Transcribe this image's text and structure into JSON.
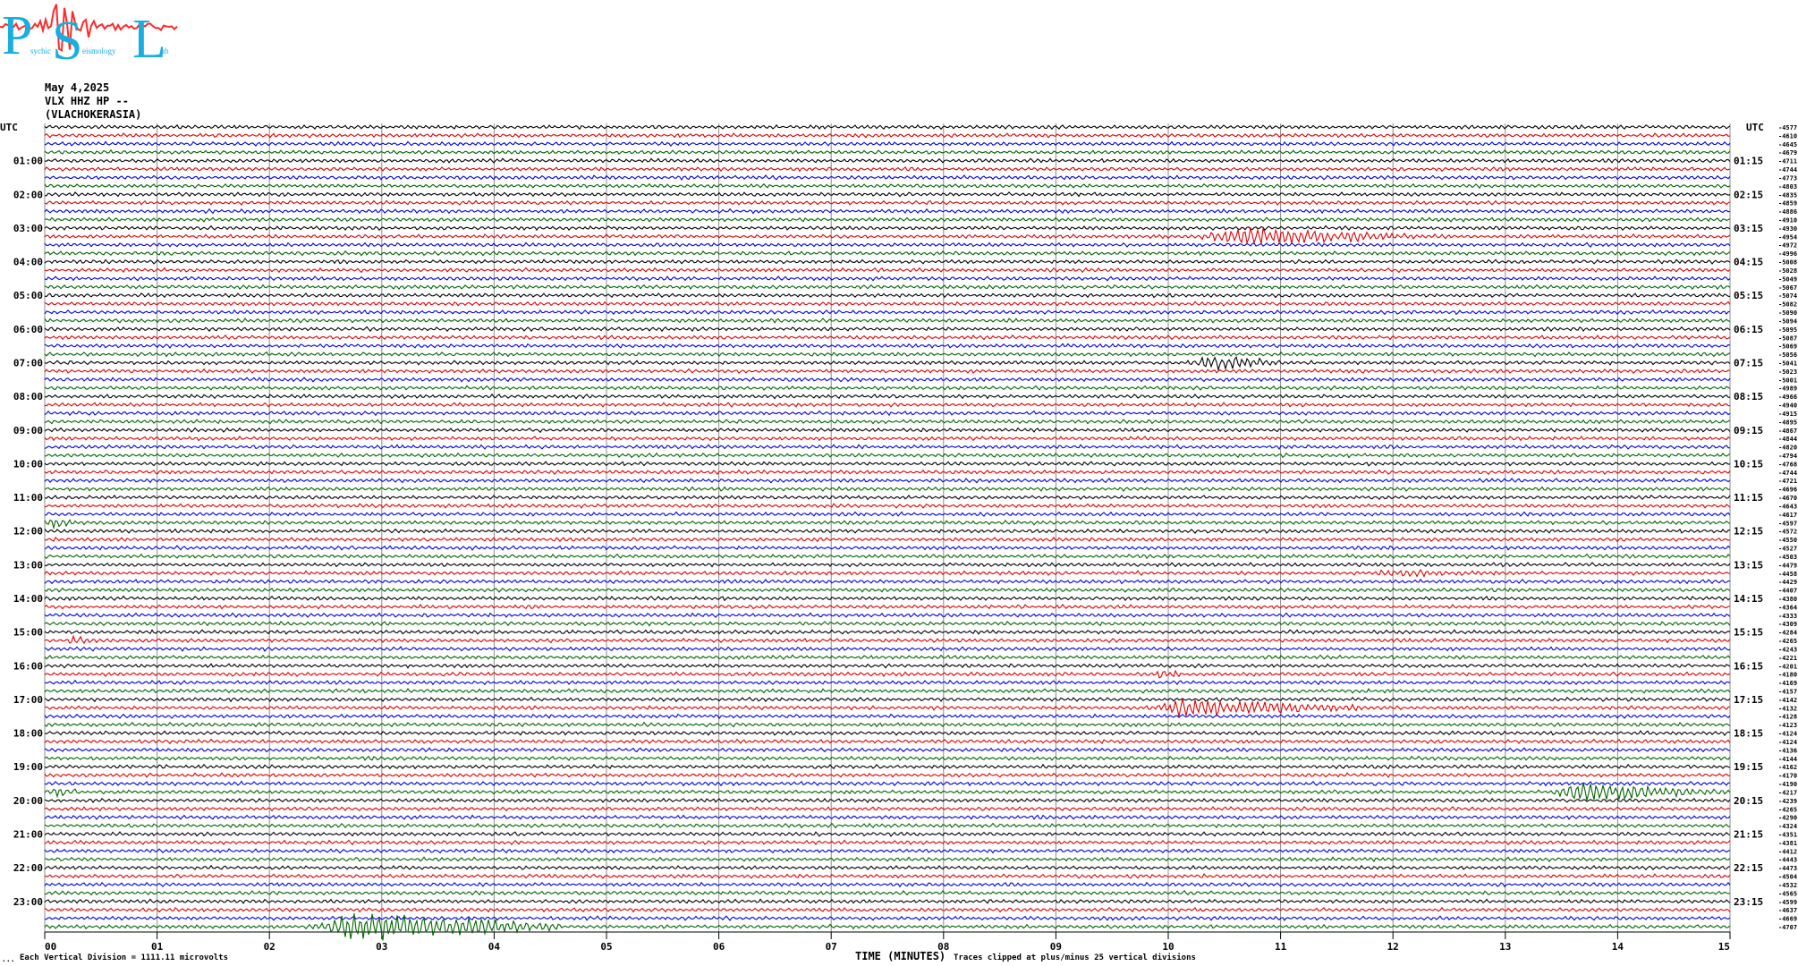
{
  "logo": {
    "letters": [
      "P",
      "S",
      "L"
    ],
    "small_words": [
      "sychic",
      "eismology",
      "ab"
    ],
    "color_primary": "#19aee0",
    "color_secondary": "#ff2a2a"
  },
  "header": {
    "date": "May 4,2025",
    "channel": "VLX HHZ HP --",
    "station": "(VLACHOKERASIA)"
  },
  "footer": {
    "xlabel": "TIME (MINUTES)",
    "division_note": "Each Vertical Division = 1111.11 microvolts",
    "clip_note": "Traces clipped at plus/minus 25 vertical divisions",
    "corner_mark": "..."
  },
  "chart_data": {
    "type": "line",
    "title": "",
    "xlabel": "TIME (MINUTES)",
    "ylabel": "",
    "x_ticks": [
      "00",
      "01",
      "02",
      "03",
      "04",
      "05",
      "06",
      "07",
      "08",
      "09",
      "10",
      "11",
      "12",
      "13",
      "14",
      "15"
    ],
    "xlim": [
      0,
      15
    ],
    "left_corner_label": "UTC",
    "right_corner_label": "UTC",
    "left_hour_labels": [
      "01:00",
      "02:00",
      "03:00",
      "04:00",
      "05:00",
      "06:00",
      "07:00",
      "08:00",
      "09:00",
      "10:00",
      "11:00",
      "12:00",
      "13:00",
      "14:00",
      "15:00",
      "16:00",
      "17:00",
      "18:00",
      "19:00",
      "20:00",
      "21:00",
      "22:00",
      "23:00"
    ],
    "right_hour_labels": [
      "01:15",
      "02:15",
      "03:15",
      "04:15",
      "05:15",
      "06:15",
      "07:15",
      "08:15",
      "09:15",
      "10:15",
      "11:15",
      "12:15",
      "13:15",
      "14:15",
      "15:15",
      "16:15",
      "17:15",
      "18:15",
      "19:15",
      "20:15",
      "21:15",
      "22:15",
      "23:15"
    ],
    "trace_count": 96,
    "minutes_per_trace": 15,
    "trace_colors": [
      "#000000",
      "#e00000",
      "#0000e0",
      "#006400"
    ],
    "grid": true,
    "trace_offsets": [
      -4577,
      -4610,
      -4645,
      -4679,
      -4711,
      -4744,
      -4773,
      -4803,
      -4835,
      -4859,
      -4886,
      -4910,
      -4930,
      -4954,
      -4972,
      -4996,
      -5008,
      -5028,
      -5049,
      -5067,
      -5074,
      -5082,
      -5090,
      -5094,
      -5095,
      -5087,
      -5069,
      -5056,
      -5041,
      -5023,
      -5001,
      -4989,
      -4966,
      -4940,
      -4915,
      -4895,
      -4867,
      -4844,
      -4820,
      -4794,
      -4768,
      -4744,
      -4721,
      -4696,
      -4670,
      -4643,
      -4617,
      -4597,
      -4572,
      -4550,
      -4527,
      -4503,
      -4479,
      -4458,
      -4429,
      -4407,
      -4380,
      -4364,
      -4333,
      -4309,
      -4284,
      -4265,
      -4243,
      -4221,
      -4201,
      -4180,
      -4169,
      -4157,
      -4142,
      -4132,
      -4128,
      -4123,
      -4124,
      -4124,
      -4136,
      -4144,
      -4162,
      -4170,
      -4190,
      -4217,
      -4239,
      -4265,
      -4290,
      -4324,
      -4351,
      -4381,
      -4412,
      -4443,
      -4473,
      -4504,
      -4532,
      -4565,
      -4599,
      -4637,
      -4669,
      -4707
    ],
    "events": [
      {
        "trace": 13,
        "start_min": 10.3,
        "end_min": 12.2,
        "amplitude": 7
      },
      {
        "trace": 28,
        "start_min": 10.2,
        "end_min": 11.0,
        "amplitude": 6
      },
      {
        "trace": 47,
        "start_min": 0.0,
        "end_min": 0.3,
        "amplitude": 3
      },
      {
        "trace": 53,
        "start_min": 11.8,
        "end_min": 13.0,
        "amplitude": 2
      },
      {
        "trace": 61,
        "start_min": 0.2,
        "end_min": 0.4,
        "amplitude": 3
      },
      {
        "trace": 65,
        "start_min": 9.9,
        "end_min": 10.1,
        "amplitude": 5
      },
      {
        "trace": 69,
        "start_min": 9.8,
        "end_min": 11.8,
        "amplitude": 7
      },
      {
        "trace": 79,
        "start_min": 0.0,
        "end_min": 0.4,
        "amplitude": 3
      },
      {
        "trace": 79,
        "start_min": 13.4,
        "end_min": 15.0,
        "amplitude": 7
      },
      {
        "trace": 95,
        "start_min": 2.4,
        "end_min": 4.6,
        "amplitude": 12
      }
    ]
  }
}
